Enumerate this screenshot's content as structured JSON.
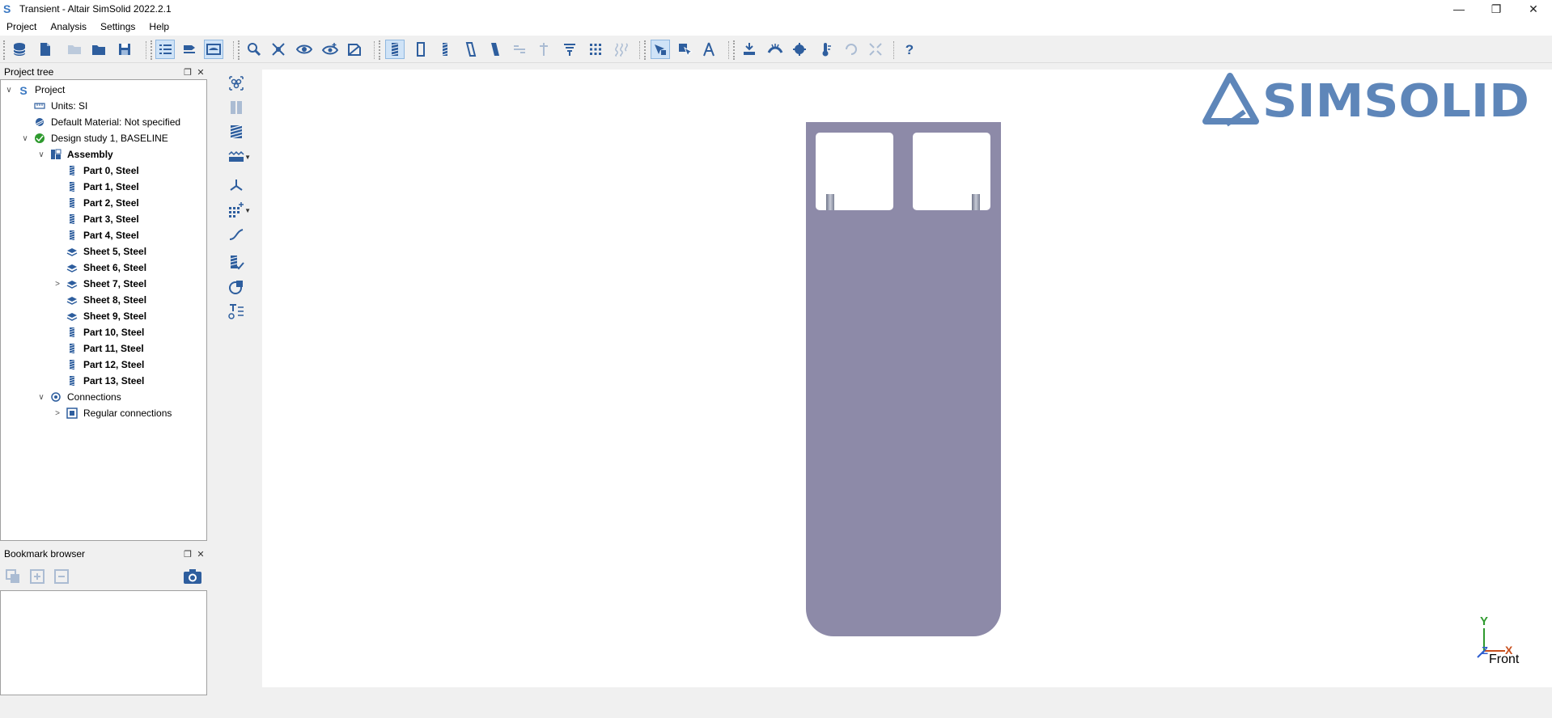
{
  "window": {
    "title": "Transient - Altair SimSolid 2022.2.1"
  },
  "menu": [
    "Project",
    "Analysis",
    "Settings",
    "Help"
  ],
  "project_tree": {
    "title": "Project tree",
    "items": [
      {
        "label": "Project",
        "icon": "simsolid-logo-icon",
        "arrow": "∨",
        "bold": false
      },
      {
        "label": "Units: SI",
        "icon": "ruler-icon",
        "arrow": "",
        "bold": false
      },
      {
        "label": "Default Material: Not specified",
        "icon": "material-icon",
        "arrow": "",
        "bold": false
      },
      {
        "label": "Design study 1, BASELINE",
        "icon": "design-study-icon",
        "arrow": "∨",
        "bold": false
      },
      {
        "label": "Assembly",
        "icon": "assembly-icon",
        "arrow": "∨",
        "bold": true
      },
      {
        "label": "Part 0, Steel",
        "icon": "part-icon",
        "arrow": "",
        "bold": true
      },
      {
        "label": "Part 1, Steel",
        "icon": "part-icon",
        "arrow": "",
        "bold": true
      },
      {
        "label": "Part 2, Steel",
        "icon": "part-icon",
        "arrow": "",
        "bold": true
      },
      {
        "label": "Part 3, Steel",
        "icon": "part-icon",
        "arrow": "",
        "bold": true
      },
      {
        "label": "Part 4, Steel",
        "icon": "part-icon",
        "arrow": "",
        "bold": true
      },
      {
        "label": "Sheet 5, Steel",
        "icon": "sheet-icon",
        "arrow": "",
        "bold": true
      },
      {
        "label": "Sheet 6, Steel",
        "icon": "sheet-icon",
        "arrow": "",
        "bold": true
      },
      {
        "label": "Sheet 7, Steel",
        "icon": "sheet-icon",
        "arrow": ">",
        "bold": true
      },
      {
        "label": "Sheet 8, Steel",
        "icon": "sheet-icon",
        "arrow": "",
        "bold": true
      },
      {
        "label": "Sheet 9, Steel",
        "icon": "sheet-icon",
        "arrow": "",
        "bold": true
      },
      {
        "label": "Part 10, Steel",
        "icon": "part-icon",
        "arrow": "",
        "bold": true
      },
      {
        "label": "Part 11, Steel",
        "icon": "part-icon",
        "arrow": "",
        "bold": true
      },
      {
        "label": "Part 12, Steel",
        "icon": "part-icon",
        "arrow": "",
        "bold": true
      },
      {
        "label": "Part 13, Steel",
        "icon": "part-icon",
        "arrow": "",
        "bold": true
      },
      {
        "label": "Connections",
        "icon": "connections-icon",
        "arrow": "∨",
        "bold": false
      },
      {
        "label": "Regular connections",
        "icon": "regular-connections-icon",
        "arrow": ">",
        "bold": false
      }
    ]
  },
  "bookmark_browser": {
    "title": "Bookmark browser"
  },
  "viewport": {
    "logo_text": "SIMSOLID",
    "triad": {
      "y": "Y",
      "z": "Z",
      "x": "X",
      "view": "Front"
    },
    "colors": {
      "part": "#8d8aa8",
      "logo": "#5e86b9",
      "accent": "#2e5e9e"
    }
  }
}
